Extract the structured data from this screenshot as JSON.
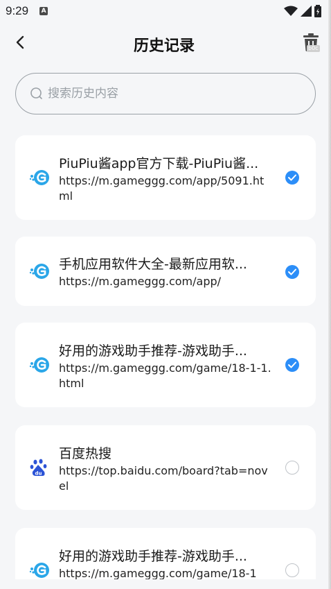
{
  "status_bar": {
    "time": "9:29",
    "notif_letter": "A"
  },
  "header": {
    "title": "历史记录",
    "badge": "b0c"
  },
  "search": {
    "placeholder": "搜索历史内容"
  },
  "items": [
    {
      "title": "PiuPiu酱app官方下载-PiuPiu酱...",
      "url": "https://m.gameggg.com/app/5091.html",
      "checked": true,
      "icon": "gameggg-logo-icon"
    },
    {
      "title": "手机应用软件大全-最新应用软...",
      "url": "https://m.gameggg.com/app/",
      "checked": true,
      "icon": "gameggg-logo-icon"
    },
    {
      "title": "好用的游戏助手推荐-游戏助手...",
      "url": "https://m.gameggg.com/game/18-1-1.html",
      "checked": true,
      "icon": "gameggg-logo-icon"
    },
    {
      "title": "百度热搜",
      "url": "https://top.baidu.com/board?tab=novel",
      "checked": false,
      "icon": "baidu-paw-icon"
    },
    {
      "title": "好用的游戏助手推荐-游戏助手...",
      "url": "https://m.gameggg.com/game/18-1",
      "checked": false,
      "icon": "gameggg-logo-icon"
    }
  ],
  "colors": {
    "accent": "#2c8ef8",
    "background": "#f5f6f8",
    "card": "#ffffff",
    "gameggg_icon": "#2aa6e8",
    "baidu_icon": "#2b53d6"
  }
}
